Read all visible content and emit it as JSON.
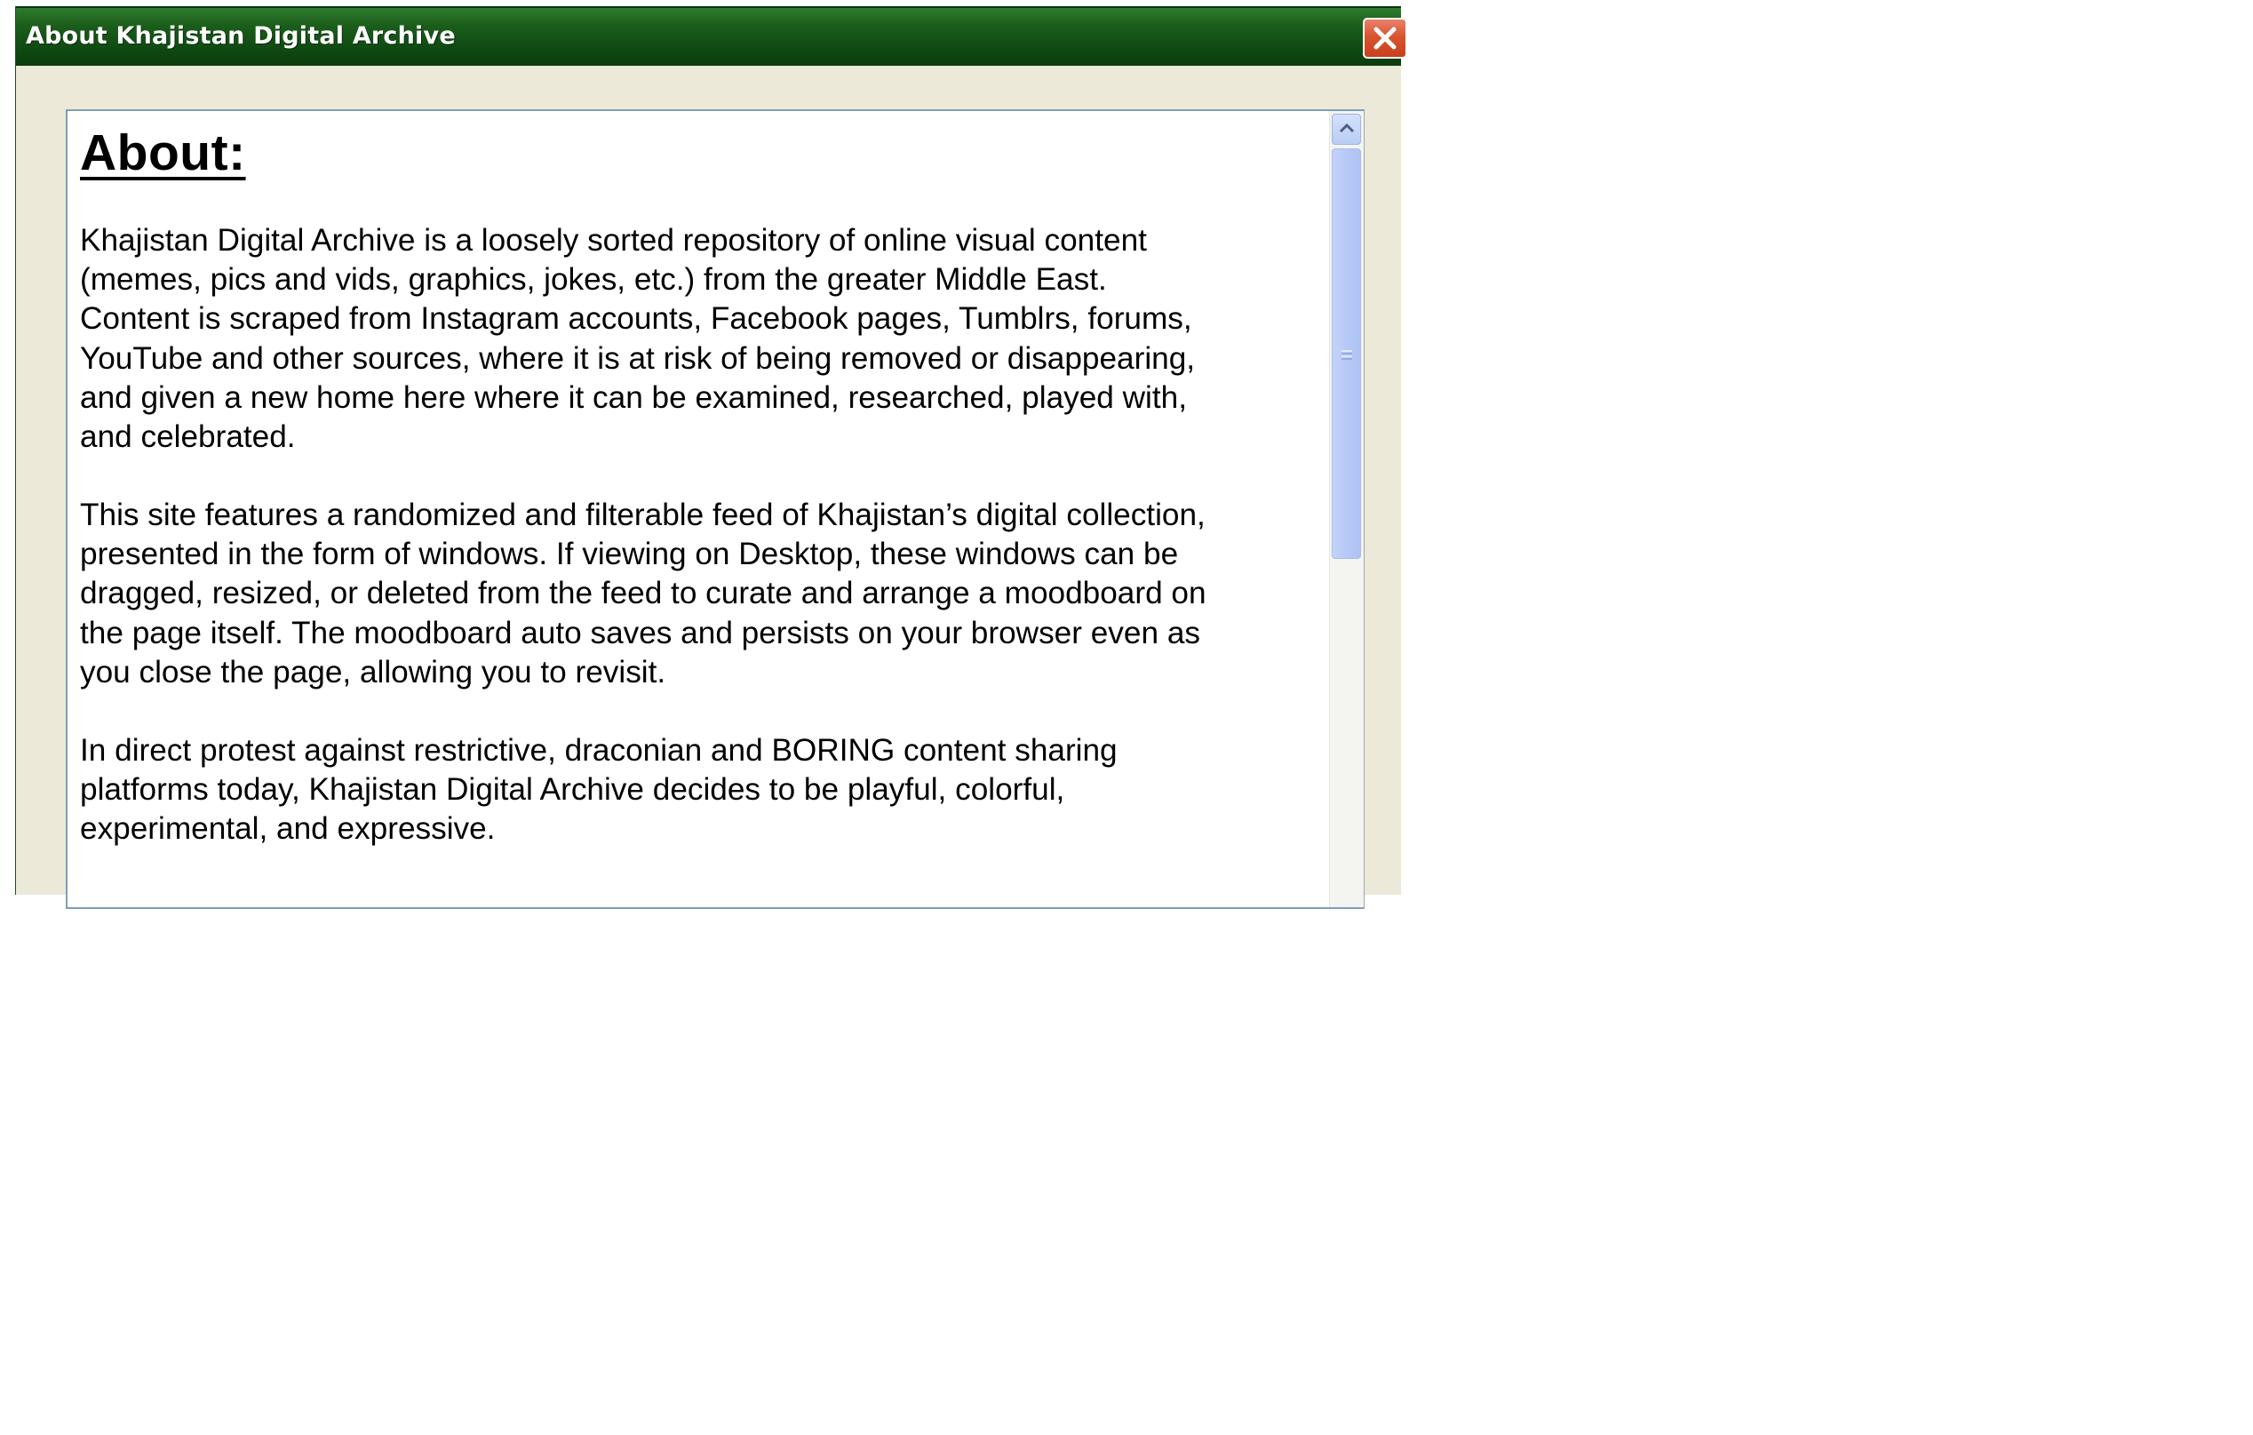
{
  "window": {
    "title": "About Khajistan Digital Archive"
  },
  "icons": {
    "close": "close-icon",
    "scroll_up": "chevron-up-icon",
    "grip": "scrollbar-grip-icon"
  },
  "colors": {
    "title_bar": "#1b5e1b",
    "close_button": "#d9542f",
    "window_background": "#ECE9D8",
    "scrollbar_thumb": "#b6c9f6"
  },
  "content": {
    "heading": "About:",
    "paragraphs": [
      "Khajistan Digital Archive is a loosely sorted repository of online visual content\n(memes, pics and vids, graphics, jokes, etc.) from the greater Middle East.\nContent is scraped from Instagram accounts, Facebook pages, Tumblrs, forums,\nYouTube and other sources, where it is at risk of being removed or disappearing,\nand given a new home here where it can be examined, researched, played with,\nand celebrated.",
      "This site features a randomized and filterable feed of Khajistan’s digital collection,\npresented in the form of windows. If viewing on Desktop, these windows can be\ndragged, resized, or deleted from the feed to curate and arrange a moodboard on\nthe page itself. The moodboard auto saves and persists on your browser even as\nyou close the page, allowing you to revisit.",
      "In direct protest against restrictive, draconian and BORING content sharing\nplatforms today, Khajistan Digital Archive decides to be playful, colorful,\nexperimental, and expressive."
    ]
  }
}
